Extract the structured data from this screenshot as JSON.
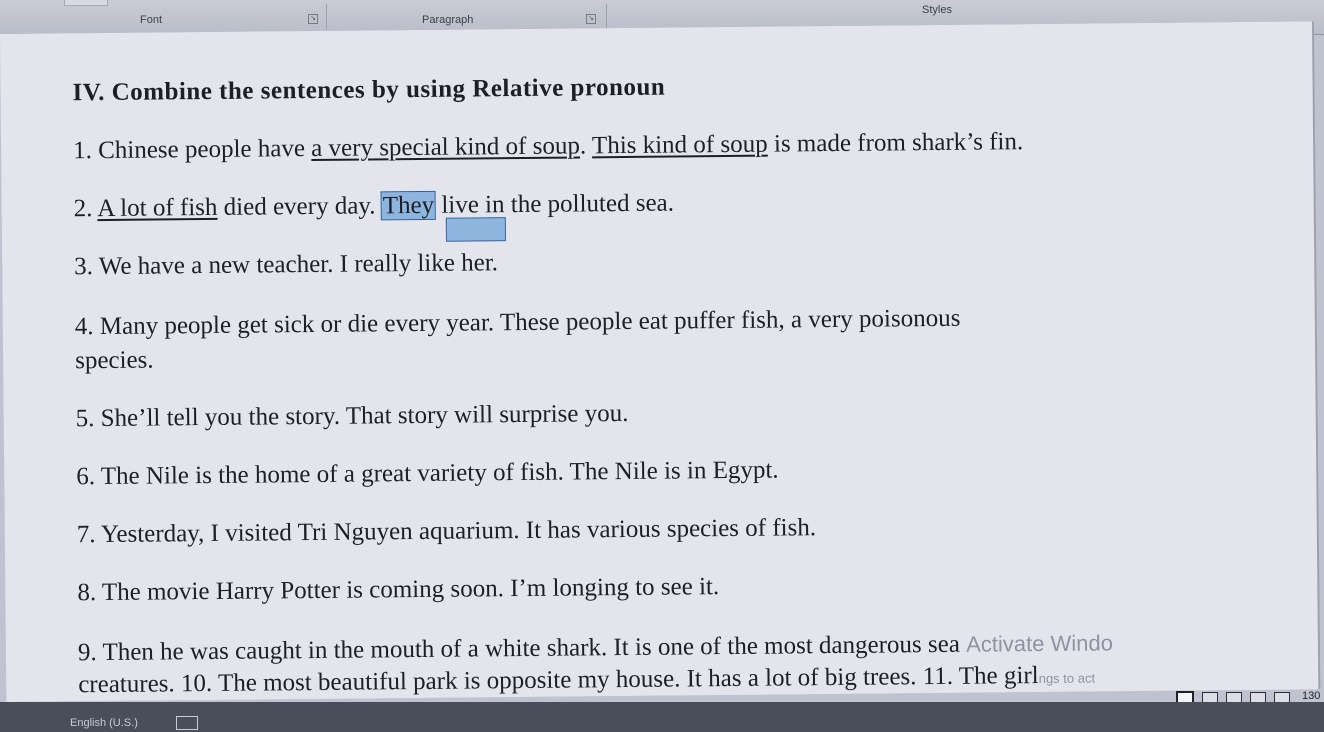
{
  "ribbon": {
    "font_group": "Font",
    "paragraph_group": "Paragraph",
    "styles_group": "Styles"
  },
  "document": {
    "title": "IV. Combine the sentences by using Relative pronoun",
    "q1": {
      "num": "1. Chinese people have ",
      "u1": "a very special kind of soup",
      "mid": ". ",
      "u2": "This kind of soup",
      "end": " is made from shark’s fin."
    },
    "q2": {
      "num": "2. ",
      "u1": "A lot of fish",
      "mid": " died every day. ",
      "sel": "They",
      "end": " live in the polluted sea."
    },
    "q3": "3. We have a new teacher. I really like her.",
    "q4a": "4. Many people get sick or die every year. These people eat puffer fish, a very poisonous",
    "q4b": "species.",
    "q5": "5. She’ll tell you the story. That story will surprise you.",
    "q6": "6. The Nile is the home of a great variety of fish. The Nile is in Egypt.",
    "q7": "7. Yesterday, I visited Tri Nguyen aquarium. It has various species of fish.",
    "q8": "8. The movie Harry Potter is coming soon. I’m longing to see it.",
    "q9": "9. Then he was caught in the mouth of a white shark. It is one of the most dangerous sea",
    "q10": "creatures. 10. The most beautiful park is opposite my house. It has a lot of big trees. 11. The girl"
  },
  "watermark": {
    "line1": "Activate Windo",
    "line2": "ngs to act"
  },
  "statusbar": {
    "language": "English (U.S.)",
    "zoom": "130"
  }
}
